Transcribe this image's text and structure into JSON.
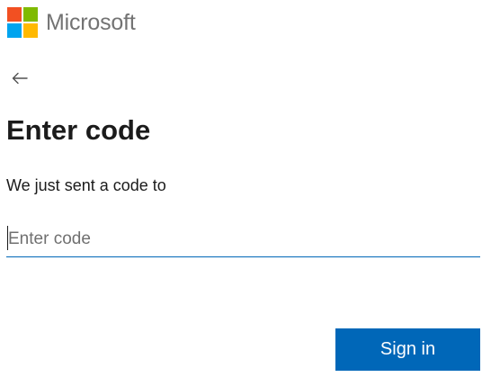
{
  "brand": {
    "name": "Microsoft",
    "logo_icon": "microsoft-logo-icon",
    "logo_colors": [
      "#f25022",
      "#7fba00",
      "#00a4ef",
      "#ffb900"
    ]
  },
  "navigation": {
    "back_icon": "arrow-left-icon"
  },
  "main": {
    "title": "Enter code",
    "subtitle": "We just sent a code to",
    "code_input": {
      "value": "",
      "placeholder": "Enter code"
    }
  },
  "actions": {
    "sign_in_label": "Sign in"
  },
  "colors": {
    "accent": "#0067b8",
    "brand_text": "#737373",
    "text": "#1b1b1b"
  }
}
